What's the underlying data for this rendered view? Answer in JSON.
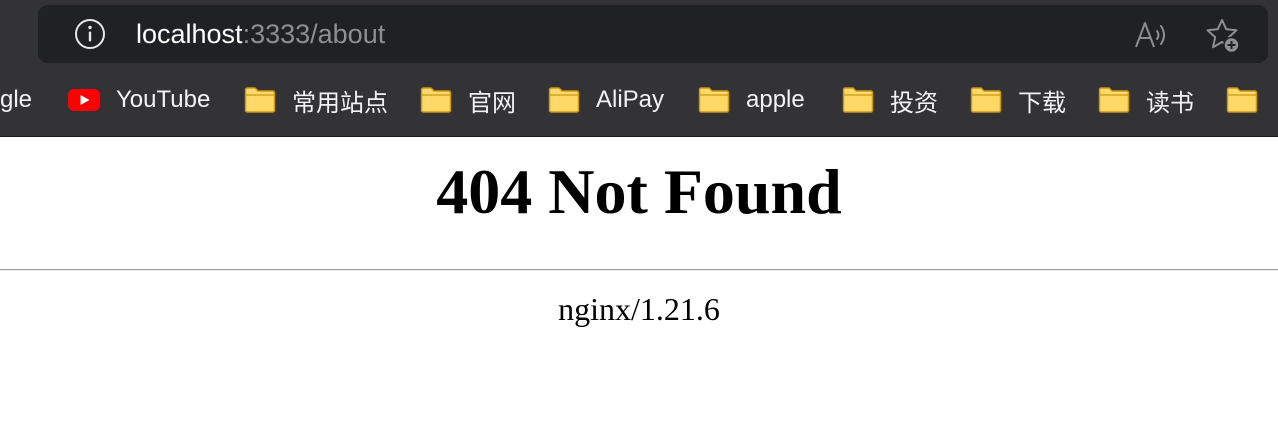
{
  "browser": {
    "address_bar": {
      "host": "localhost",
      "rest": ":3333/about",
      "info_icon": "info-circle-icon",
      "read_aloud_icon": "read-aloud-icon",
      "favorites_icon": "add-favorite-star-icon"
    },
    "bookmarks": [
      {
        "label": "gle",
        "icon": "none"
      },
      {
        "label": "YouTube",
        "icon": "youtube-icon"
      },
      {
        "label": "常用站点",
        "icon": "folder-icon"
      },
      {
        "label": "官网",
        "icon": "folder-icon"
      },
      {
        "label": "AliPay",
        "icon": "folder-icon"
      },
      {
        "label": "apple",
        "icon": "folder-icon"
      },
      {
        "label": "投资",
        "icon": "folder-icon"
      },
      {
        "label": "下载",
        "icon": "folder-icon"
      },
      {
        "label": "读书",
        "icon": "folder-icon"
      },
      {
        "label": "",
        "icon": "folder-icon"
      }
    ]
  },
  "page": {
    "title": "404 Not Found",
    "server": "nginx/1.21.6"
  },
  "colors": {
    "toolbar_bg": "#333336",
    "urlbar_bg": "#202124",
    "folder_fill": "#FFD966",
    "folder_stroke": "#C9961A",
    "youtube_red": "#FF0000"
  }
}
